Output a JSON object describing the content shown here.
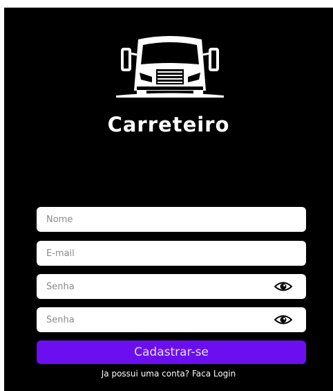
{
  "app": {
    "brand": "Carreteiro",
    "logo_icon": "truck-icon"
  },
  "form": {
    "name_placeholder": "Nome",
    "email_placeholder": "E-mail",
    "password_placeholder": "Senha",
    "confirm_password_placeholder": "Senha",
    "visibility_icon": "eye-icon",
    "submit_label": "Cadastrar-se",
    "login_link": "Ja possui uma conta? Faca Login"
  },
  "colors": {
    "background": "#000000",
    "accent": "#6b0ff0",
    "field_background": "#ffffff"
  }
}
